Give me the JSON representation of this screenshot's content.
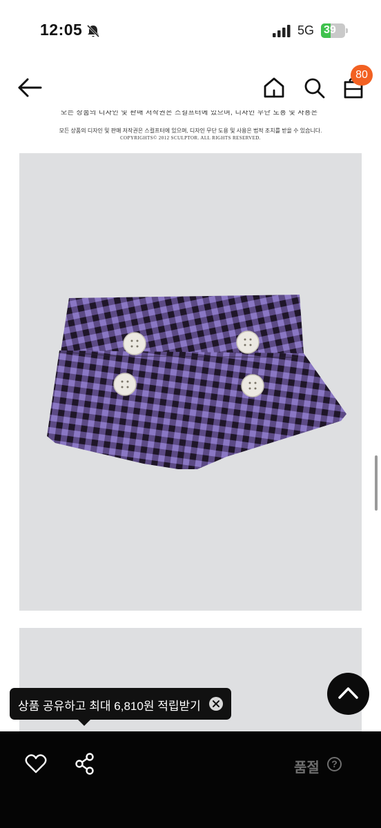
{
  "status_bar": {
    "time": "12:05",
    "network": "5G",
    "battery_level": "39",
    "battery_fraction": 0.39,
    "icons": [
      "bell-muted-icon",
      "signal-icon",
      "battery-charging-icon"
    ]
  },
  "header": {
    "icons": [
      "back-arrow-icon",
      "home-icon",
      "search-icon",
      "shopping-bag-icon"
    ],
    "cart_count": "80"
  },
  "notice": {
    "line1": "모든 상품의 디자인 및 판매 저작권은 스컬프터에 있으며, 디자인 무단 도용 및 사용은 법적 조치를 받을 수 있습니다.",
    "copyright": "COPYRIGHTS© 2012 SCULPTOR. ALL RIGHTS RESERVED."
  },
  "product": {
    "image_subject": "purple gingham shorts with four white buttons",
    "colors": {
      "background": "#dedfe1",
      "fabric_purple": "#7a63b3",
      "fabric_dark": "#24192f",
      "button_white": "#ece9e2"
    }
  },
  "tooltip": {
    "text": "상품 공유하고 최대 6,810원 적립받기"
  },
  "bottom_bar": {
    "soldout_label": "품절",
    "help_symbol": "?",
    "icons": [
      "heart-icon",
      "share-icon"
    ]
  },
  "accent_colors": {
    "badge": "#f26122",
    "bar": "#050505"
  }
}
